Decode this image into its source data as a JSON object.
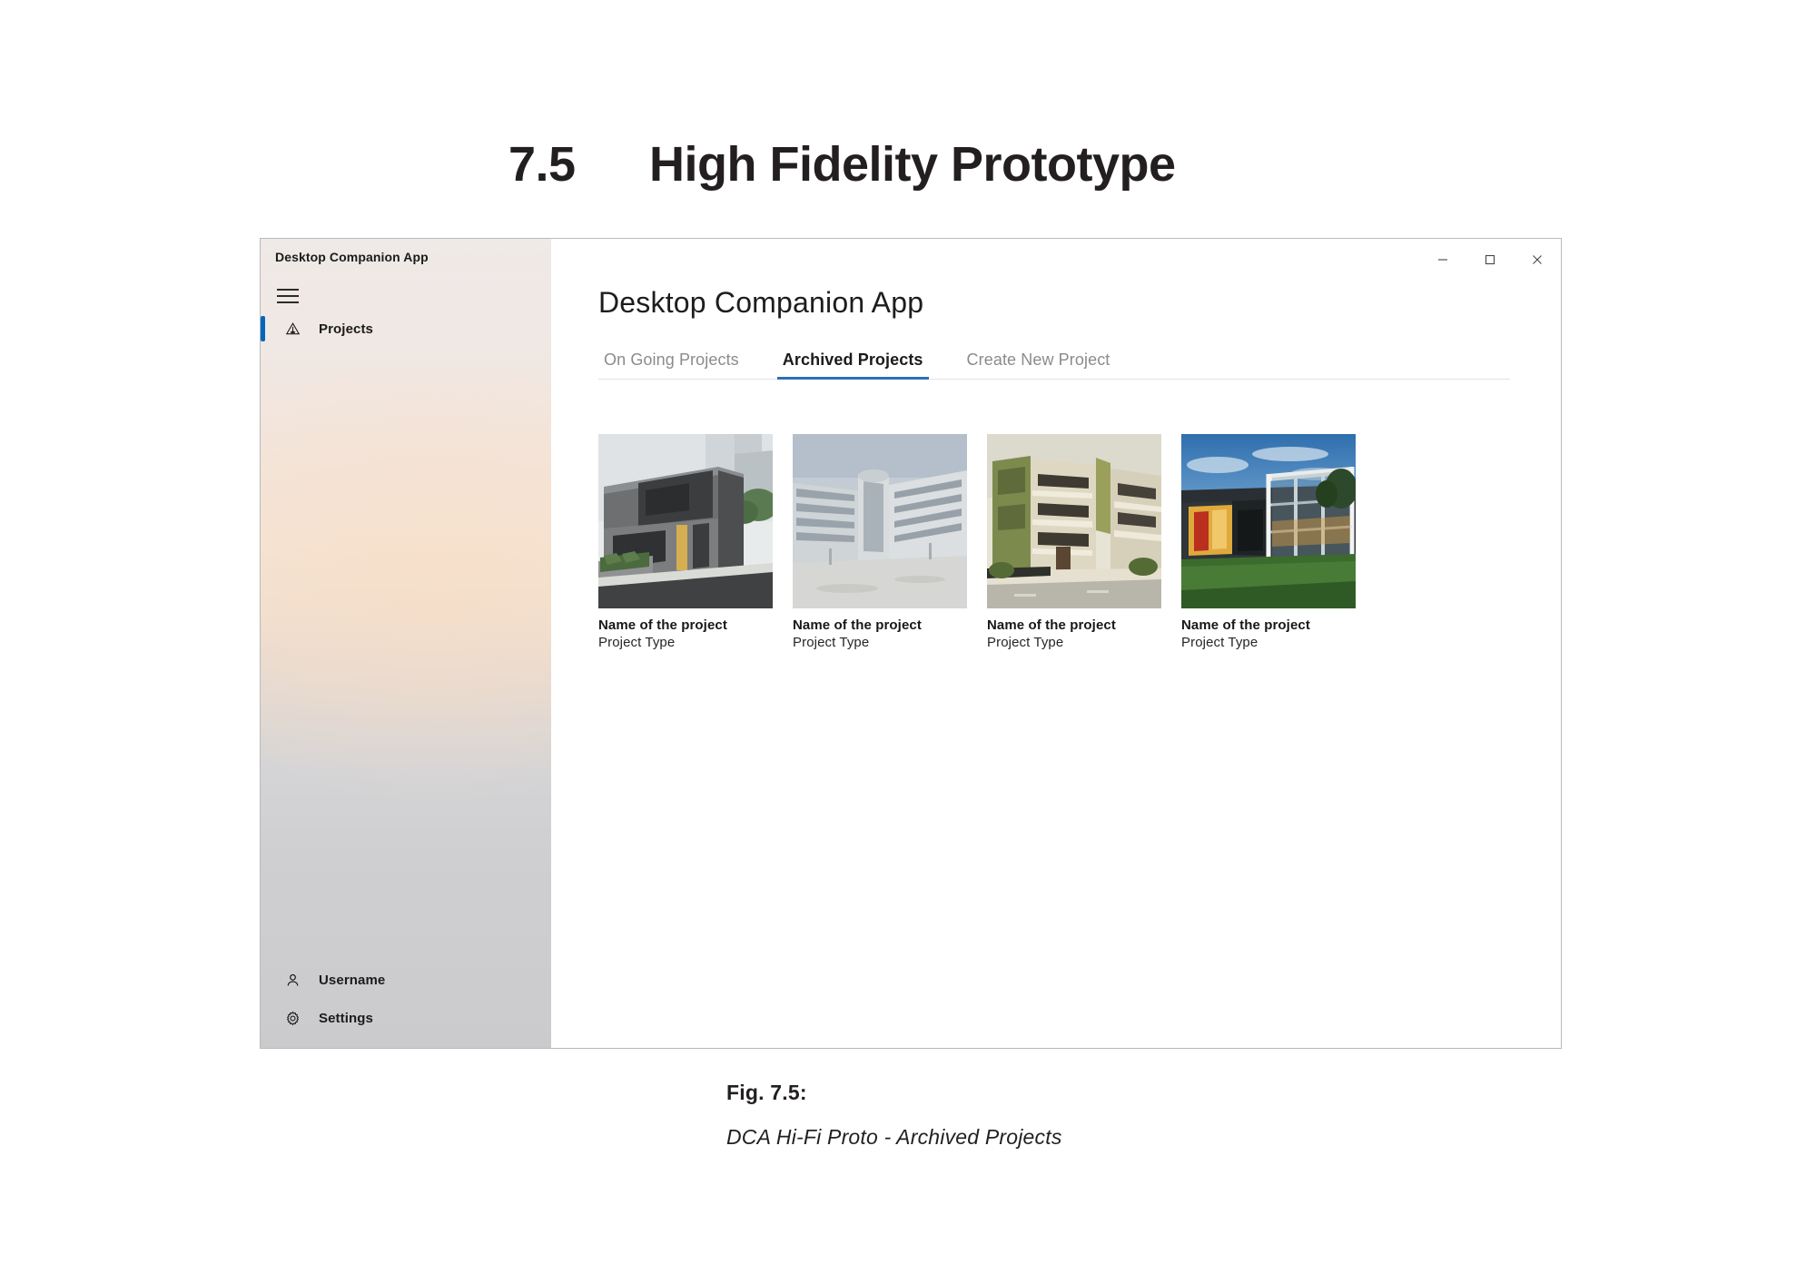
{
  "document": {
    "section_number": "7.5",
    "section_title": "High Fidelity Prototype",
    "caption_label": "Fig. 7.5:",
    "caption_text": "DCA Hi-Fi Proto - Archived Projects"
  },
  "window": {
    "title": "Desktop Companion App",
    "controls": {
      "minimize": "─",
      "maximize": "□",
      "close": "×"
    }
  },
  "sidebar": {
    "menu_icon": "hamburger-icon",
    "items": [
      {
        "label": "Projects",
        "icon": "projects-icon",
        "selected": true
      }
    ],
    "bottom_items": [
      {
        "label": "Username",
        "icon": "person-icon"
      },
      {
        "label": "Settings",
        "icon": "gear-icon"
      }
    ]
  },
  "main": {
    "heading": "Desktop Companion App",
    "tabs": [
      {
        "label": "On Going Projects",
        "active": false
      },
      {
        "label": "Archived Projects",
        "active": true
      },
      {
        "label": "Create New Project",
        "active": false
      }
    ],
    "projects": [
      {
        "name": "Name of the project",
        "type": "Project Type"
      },
      {
        "name": "Name of the project",
        "type": "Project Type"
      },
      {
        "name": "Name of the project",
        "type": "Project Type"
      },
      {
        "name": "Name of the project",
        "type": "Project Type"
      }
    ]
  },
  "colors": {
    "accent_blue": "#0067c0",
    "tab_underline": "#2f6fb5",
    "sidebar_top": "#efe9e7",
    "sidebar_mid": "#f5e3d4",
    "sidebar_bottom": "#cbcbcd"
  }
}
